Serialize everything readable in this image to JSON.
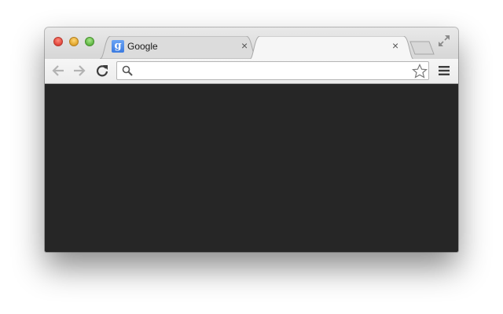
{
  "window": {
    "controls": [
      "close",
      "minimize",
      "zoom"
    ]
  },
  "tabs": [
    {
      "title": "Google",
      "favicon_letter": "g",
      "favicon_icon": "google-favicon-icon",
      "close_glyph": "×",
      "active": false
    },
    {
      "title": "",
      "close_glyph": "×",
      "active": true
    }
  ],
  "toolbar": {
    "back_icon": "arrow-left-icon",
    "forward_icon": "arrow-right-icon",
    "reload_icon": "reload-icon",
    "omnibox": {
      "value": "",
      "placeholder": ""
    },
    "bookmark_icon": "star-outline-icon",
    "menu_icon": "hamburger-menu-icon"
  },
  "colors": {
    "content_background": "#262626",
    "close": "#e0443a",
    "minimize": "#e0a42a",
    "zoom": "#5fb543",
    "favicon": "#3a7ae0"
  }
}
